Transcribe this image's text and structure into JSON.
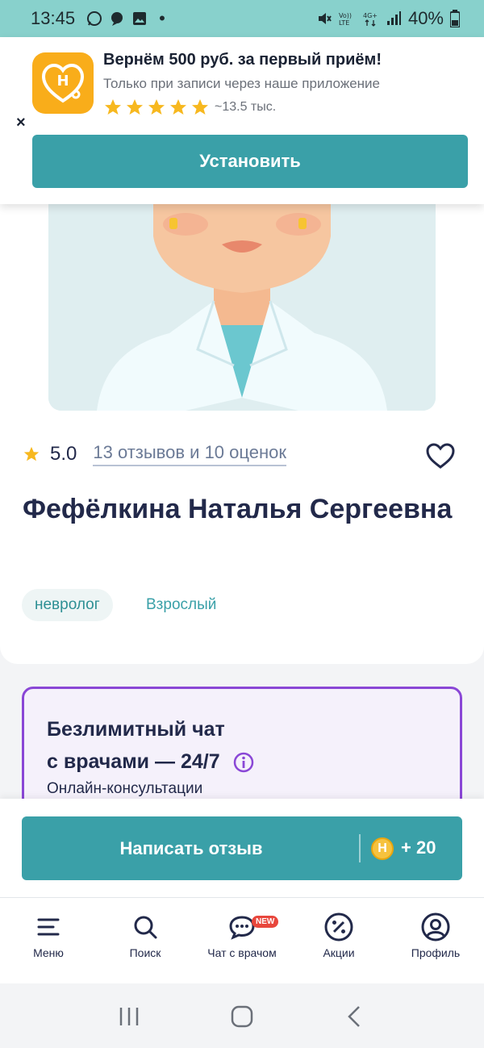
{
  "status_bar": {
    "time": "13:45",
    "battery": "40%",
    "left_icons": [
      "whatsapp-icon",
      "chat-bubble-icon",
      "image-icon"
    ],
    "right_icons": [
      "mute-icon",
      "volte-icon",
      "4g-icon",
      "signal-icon",
      "battery-icon"
    ]
  },
  "banner": {
    "title": "Вернём 500 руб. за первый приём!",
    "subtitle": "Только при записи через наше приложение",
    "rating_stars": 5,
    "rating_count": "~13.5 тыс.",
    "close_label": "×",
    "install_label": "Установить",
    "colors": {
      "app_icon": "#f9ad1a",
      "button": "#3aa0a8"
    }
  },
  "doctor": {
    "rating": "5.0",
    "reviews_link": "13 отзывов и 10 оценок",
    "name": "Фефёлкина Наталья Сергеевна",
    "specialty": "невролог",
    "age_group": "Взрослый"
  },
  "promo": {
    "title_line1": "Безлимитный чат",
    "title_line2": "с врачами — 24/7",
    "subtitle": "Онлайн-консультации",
    "border_color": "#8a47d6"
  },
  "review_bar": {
    "button_label": "Написать отзыв",
    "coin_letter": "Н",
    "bonus": "+ 20"
  },
  "tabs": [
    {
      "label": "Меню",
      "icon": "menu-icon"
    },
    {
      "label": "Поиск",
      "icon": "search-icon"
    },
    {
      "label": "Чат с врачом",
      "icon": "chat-icon",
      "badge": "NEW"
    },
    {
      "label": "Акции",
      "icon": "percent-icon"
    },
    {
      "label": "Профиль",
      "icon": "profile-icon"
    }
  ],
  "android_nav": [
    "recent-apps-icon",
    "home-icon",
    "back-icon"
  ]
}
